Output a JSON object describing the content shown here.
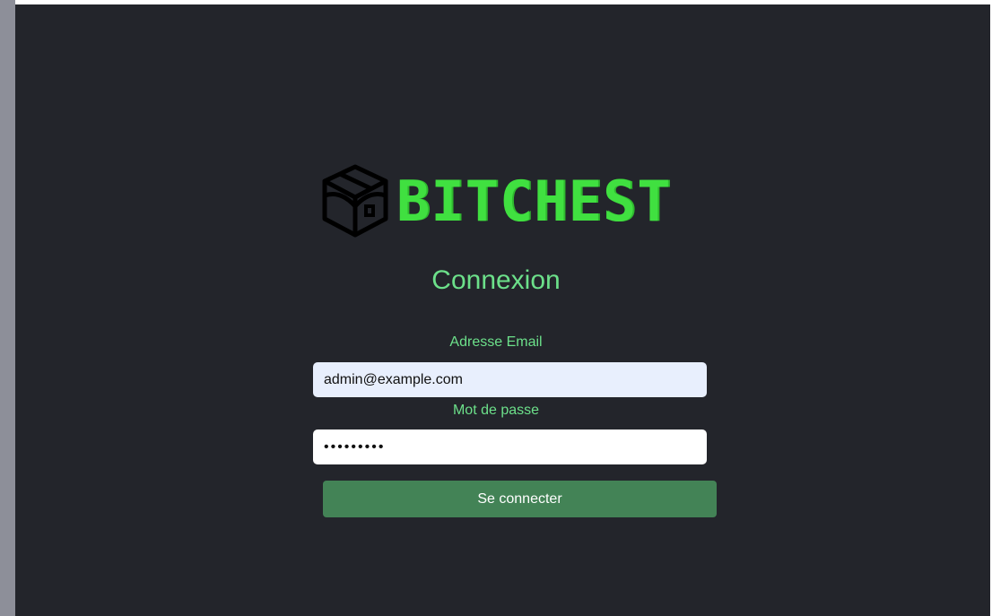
{
  "brand": {
    "name": "BITCHEST",
    "logo_icon": "treasure-chest-icon",
    "color": "#40e040"
  },
  "login_form": {
    "title": "Connexion",
    "email_label": "Adresse Email",
    "email_value": "admin@example.com",
    "password_label": "Mot de passe",
    "password_value": "•••••••••",
    "submit_label": "Se connecter"
  },
  "colors": {
    "background": "#23252b",
    "accent_text": "#6ce08a",
    "button": "#438356"
  }
}
